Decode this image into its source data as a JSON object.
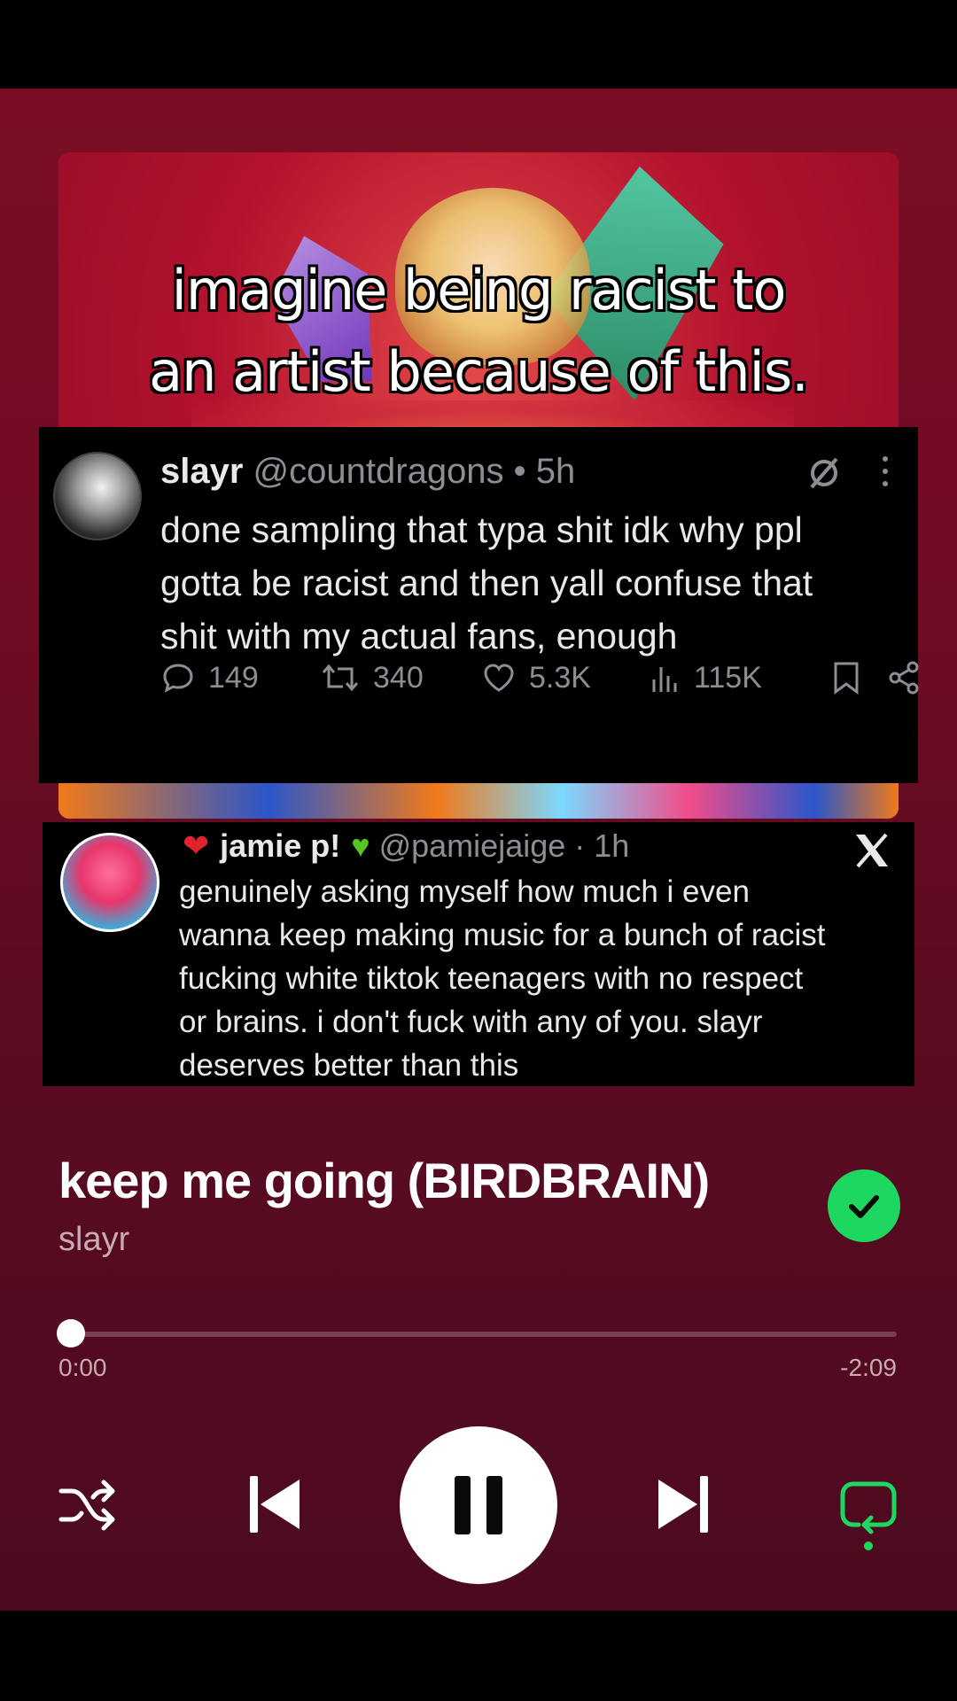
{
  "caption": {
    "line1": "imagine being racist to",
    "line2": "an artist because of this."
  },
  "tweet1": {
    "name": "slayr",
    "handle": "@countdragons",
    "time": "5h",
    "text_lines": [
      "done sampling that typa shit idk why ppl",
      "gotta be racist and then yall confuse that",
      "shit with my actual fans, enough"
    ],
    "stats": {
      "replies": "149",
      "retweets": "340",
      "likes": "5.3K",
      "views": "115K"
    }
  },
  "tweet2": {
    "name": "jamie p!",
    "handle": "@pamiejaige",
    "time": "1h",
    "text_lines": [
      "genuinely asking myself how much i even",
      "wanna keep making music for a bunch of racist",
      "fucking white tiktok teenagers with no respect",
      "or brains. i don't fuck with any of you. slayr",
      "deserves better than this"
    ]
  },
  "player": {
    "title": "keep me going (BIRDBRAIN)",
    "artist": "slayr",
    "elapsed": "0:00",
    "remaining": "-2:09",
    "progress": 0.0,
    "liked": true,
    "accent_color": "#1ed760",
    "background_color": "#6e0c24",
    "icons": {
      "shuffle": "shuffle-icon",
      "previous": "skip-previous-icon",
      "play_pause": "pause-icon",
      "next": "skip-next-icon",
      "repeat": "repeat-icon"
    }
  }
}
